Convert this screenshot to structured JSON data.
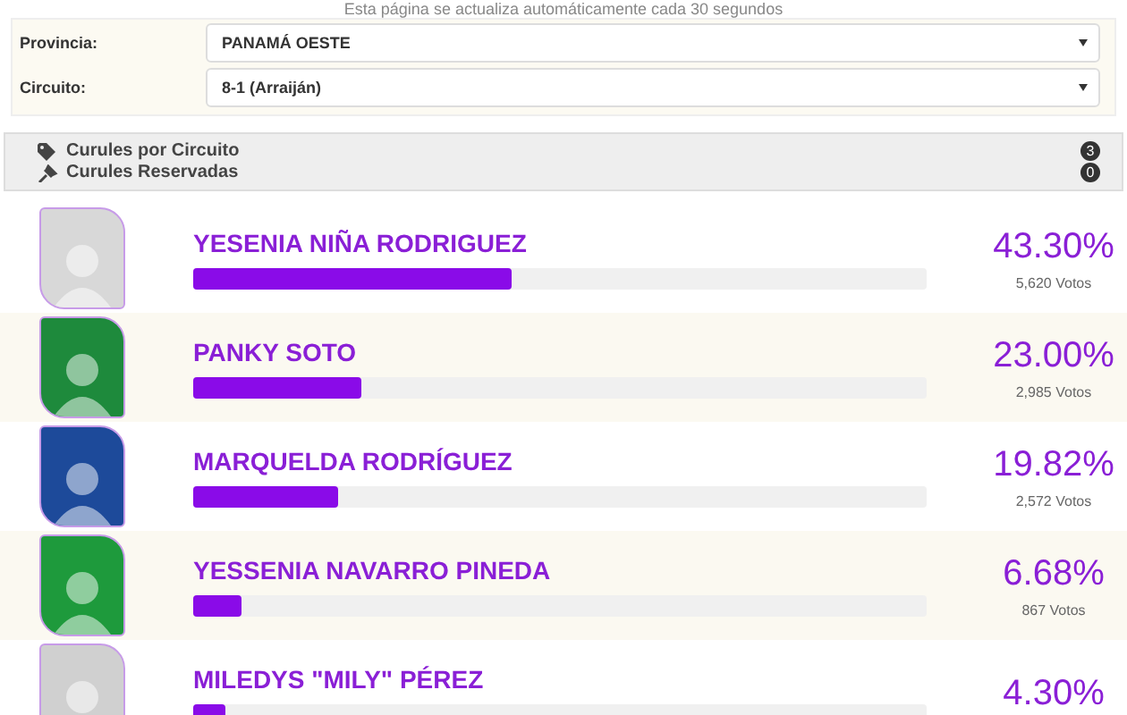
{
  "notice": "Esta página se actualiza automáticamente cada 30 segundos",
  "filters": [
    {
      "label": "Provincia:",
      "value": "PANAMÁ OESTE"
    },
    {
      "label": "Circuito:",
      "value": "8-1 (Arraiján)"
    }
  ],
  "summary": [
    {
      "kind": "tag",
      "label": "Curules por Circuito",
      "count": "3"
    },
    {
      "kind": "pin",
      "label": "Curules Reservadas",
      "count": "0"
    }
  ],
  "candidates": [
    {
      "name": "YESENIA NIÑA RODRIGUEZ",
      "level": 0.433,
      "percent": "43.30%",
      "votes": "5,620 Votos",
      "color": "#d8d8d8"
    },
    {
      "name": "PANKY SOTO",
      "level": 0.23,
      "percent": "23.00%",
      "votes": "2,985 Votos",
      "color": "#1e8a3c"
    },
    {
      "name": "MARQUELDA RODRÍGUEZ",
      "level": 0.1982,
      "percent": "19.82%",
      "votes": "2,572 Votos",
      "color": "#1d4a9a"
    },
    {
      "name": "YESSENIA NAVARRO PINEDA",
      "level": 0.0668,
      "percent": "6.68%",
      "votes": "867 Votos",
      "color": "#1e9a3c"
    },
    {
      "name": "MILEDYS \"MILY\" PÉREZ",
      "level": 0.043,
      "percent": "4.30%",
      "color": "#d0d0d0"
    }
  ]
}
